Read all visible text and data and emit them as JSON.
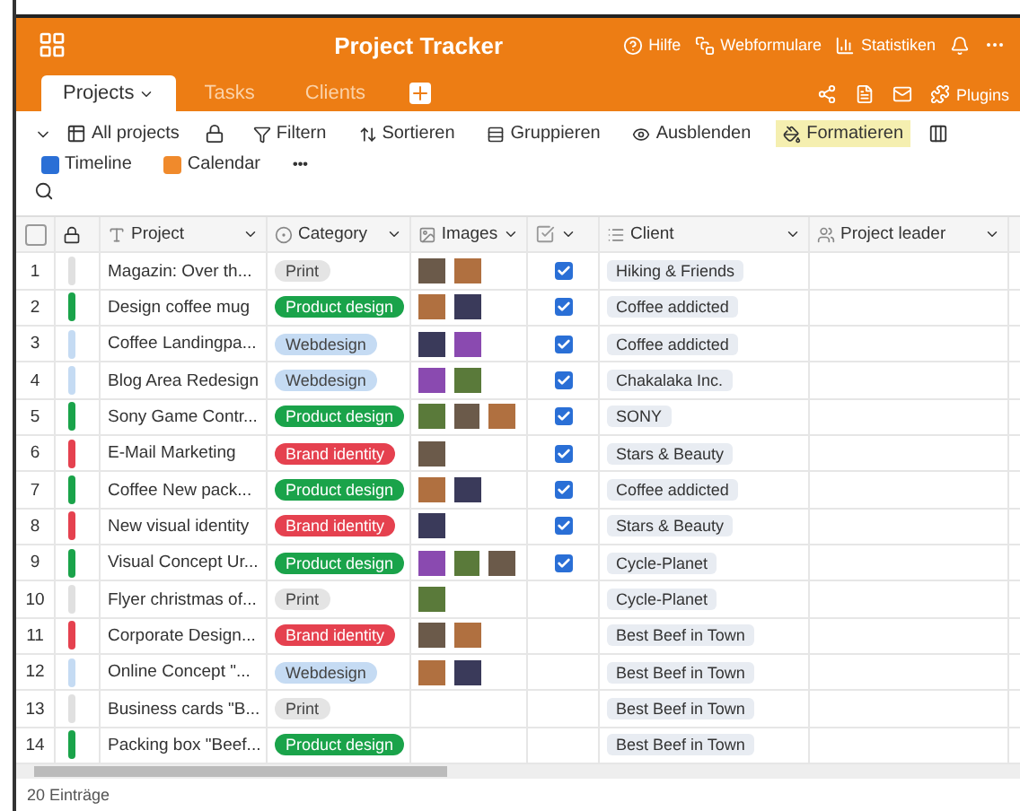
{
  "header": {
    "title": "Project Tracker",
    "actions": [
      "Hilfe",
      "Webformulare",
      "Statistiken"
    ]
  },
  "tabs": [
    {
      "label": "Projects",
      "selected": true
    },
    {
      "label": "Tasks",
      "selected": false
    },
    {
      "label": "Clients",
      "selected": false
    }
  ],
  "tab_actions": {
    "plugins": "Plugins"
  },
  "toolbar": {
    "view": "All projects",
    "buttons": [
      {
        "label": "Filtern",
        "kind": "filter",
        "selected": false
      },
      {
        "label": "Sortieren",
        "kind": "sort",
        "selected": false
      },
      {
        "label": "Gruppieren",
        "kind": "group",
        "selected": false
      },
      {
        "label": "Ausblenden",
        "kind": "hide",
        "selected": false
      },
      {
        "label": "Formatieren",
        "kind": "format",
        "selected": true
      }
    ],
    "views": [
      {
        "label": "Timeline",
        "color": "#2a6fd6"
      },
      {
        "label": "Calendar",
        "color": "#f08a2c"
      }
    ],
    "more": "•••"
  },
  "table": {
    "select_all": {
      "checked": false
    },
    "columns": [
      "Project",
      "Category",
      "Images",
      "Client",
      "Project leader"
    ],
    "rows": [
      {
        "number": "1",
        "color": "#e0e0e0",
        "project": "Magazin: Over th...",
        "category": {
          "label": "Print",
          "color": "#e4e4e4"
        },
        "images": [
          {
            "kind": "photo"
          },
          {
            "kind": "photo"
          }
        ],
        "done": true,
        "client": "Hiking & Friends"
      },
      {
        "number": "2",
        "color": "#1aa34a",
        "project": "Design coffee mug",
        "category": {
          "label": "Product design",
          "color": "#1aa34a"
        },
        "images": [
          {
            "kind": "photo"
          },
          {
            "kind": "photo"
          }
        ],
        "done": true,
        "client": "Coffee addicted"
      },
      {
        "number": "3",
        "color": "#c5dbf3",
        "project": "Coffee Landingpa...",
        "category": {
          "label": "Webdesign",
          "color": "#c5dbf3"
        },
        "images": [
          {
            "kind": "photo"
          },
          {
            "kind": "photo"
          }
        ],
        "done": true,
        "client": "Coffee addicted"
      },
      {
        "number": "4",
        "color": "#c5dbf3",
        "project": "Blog Area Redesign",
        "category": {
          "label": "Webdesign",
          "color": "#c5dbf3"
        },
        "images": [
          {
            "kind": "photo"
          },
          {
            "kind": "photo"
          }
        ],
        "done": true,
        "client": "Chakalaka Inc."
      },
      {
        "number": "5",
        "color": "#1aa34a",
        "project": "Sony Game Contr...",
        "category": {
          "label": "Product design",
          "color": "#1aa34a"
        },
        "images": [
          {
            "kind": "photo"
          },
          {
            "kind": "photo"
          },
          {
            "kind": "photo"
          }
        ],
        "done": true,
        "client": "SONY"
      },
      {
        "number": "6",
        "color": "#e5414f",
        "project": "E-Mail Marketing",
        "category": {
          "label": "Brand identity",
          "color": "#e5414f"
        },
        "images": [
          {
            "kind": "photo"
          }
        ],
        "done": true,
        "client": "Stars & Beauty"
      },
      {
        "number": "7",
        "color": "#1aa34a",
        "project": "Coffee New pack...",
        "category": {
          "label": "Product design",
          "color": "#1aa34a"
        },
        "images": [
          {
            "kind": "photo"
          },
          {
            "kind": "photo"
          }
        ],
        "done": true,
        "client": "Coffee addicted"
      },
      {
        "number": "8",
        "color": "#e5414f",
        "project": "New visual identity",
        "category": {
          "label": "Brand identity",
          "color": "#e5414f"
        },
        "images": [
          {
            "kind": "photo"
          }
        ],
        "done": true,
        "client": "Stars & Beauty"
      },
      {
        "number": "9",
        "color": "#1aa34a",
        "project": "Visual Concept Ur...",
        "category": {
          "label": "Product design",
          "color": "#1aa34a"
        },
        "images": [
          {
            "kind": "photo"
          },
          {
            "kind": "photo"
          },
          {
            "kind": "photo"
          }
        ],
        "done": true,
        "client": "Cycle-Planet"
      },
      {
        "number": "10",
        "color": "#e0e0e0",
        "project": "Flyer christmas of...",
        "category": {
          "label": "Print",
          "color": "#e4e4e4"
        },
        "images": [
          {
            "kind": "photo"
          }
        ],
        "done": false,
        "client": "Cycle-Planet"
      },
      {
        "number": "11",
        "color": "#e5414f",
        "project": "Corporate Design...",
        "category": {
          "label": "Brand identity",
          "color": "#e5414f"
        },
        "images": [
          {
            "kind": "photo"
          },
          {
            "kind": "photo"
          }
        ],
        "done": false,
        "client": "Best Beef in Town"
      },
      {
        "number": "12",
        "color": "#c5dbf3",
        "project": "Online Concept \"...",
        "category": {
          "label": "Webdesign",
          "color": "#c5dbf3"
        },
        "images": [
          {
            "kind": "photo"
          },
          {
            "kind": "photo"
          }
        ],
        "done": false,
        "client": "Best Beef in Town"
      },
      {
        "number": "13",
        "color": "#e0e0e0",
        "project": "Business cards \"B...",
        "category": {
          "label": "Print",
          "color": "#e4e4e4"
        },
        "done": false,
        "client": "Best Beef in Town"
      },
      {
        "number": "14",
        "color": "#1aa34a",
        "project": "Packing box \"Beef...",
        "category": {
          "label": "Product design",
          "color": "#1aa34a"
        },
        "done": false,
        "client": "Best Beef in Town"
      }
    ]
  },
  "status_bar": {
    "count": "20 Einträge"
  }
}
